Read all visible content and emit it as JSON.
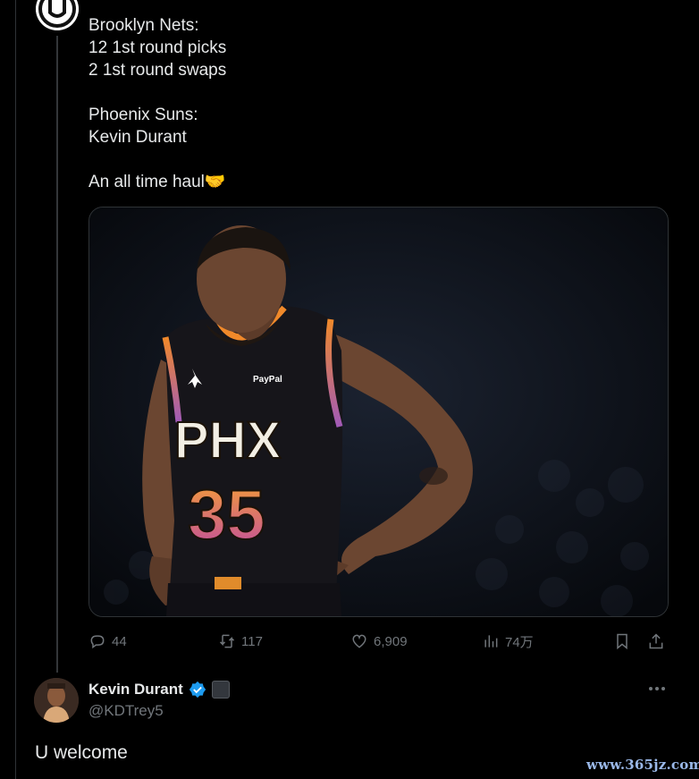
{
  "tweet": {
    "text": "Brooklyn Nets:\n12 1st round picks\n2 1st round swaps\n\nPhoenix Suns:\nKevin Durant\n\nAn all time haul🤝",
    "image": {
      "jersey_team": "PHX",
      "jersey_number": "35",
      "sponsor": "PayPal"
    },
    "stats": {
      "replies": "44",
      "retweets": "117",
      "likes": "6,909",
      "views": "74万"
    }
  },
  "reply": {
    "display_name": "Kevin Durant",
    "handle": "@KDTrey5",
    "text": "U welcome",
    "verified_color": "#1d9bf0"
  },
  "watermark": "www.365jz.com",
  "colors": {
    "background": "#000000",
    "text": "#e7e9ea",
    "muted": "#71767b",
    "jersey_orange": "#f0892a",
    "jersey_purple": "#a15ab8"
  }
}
